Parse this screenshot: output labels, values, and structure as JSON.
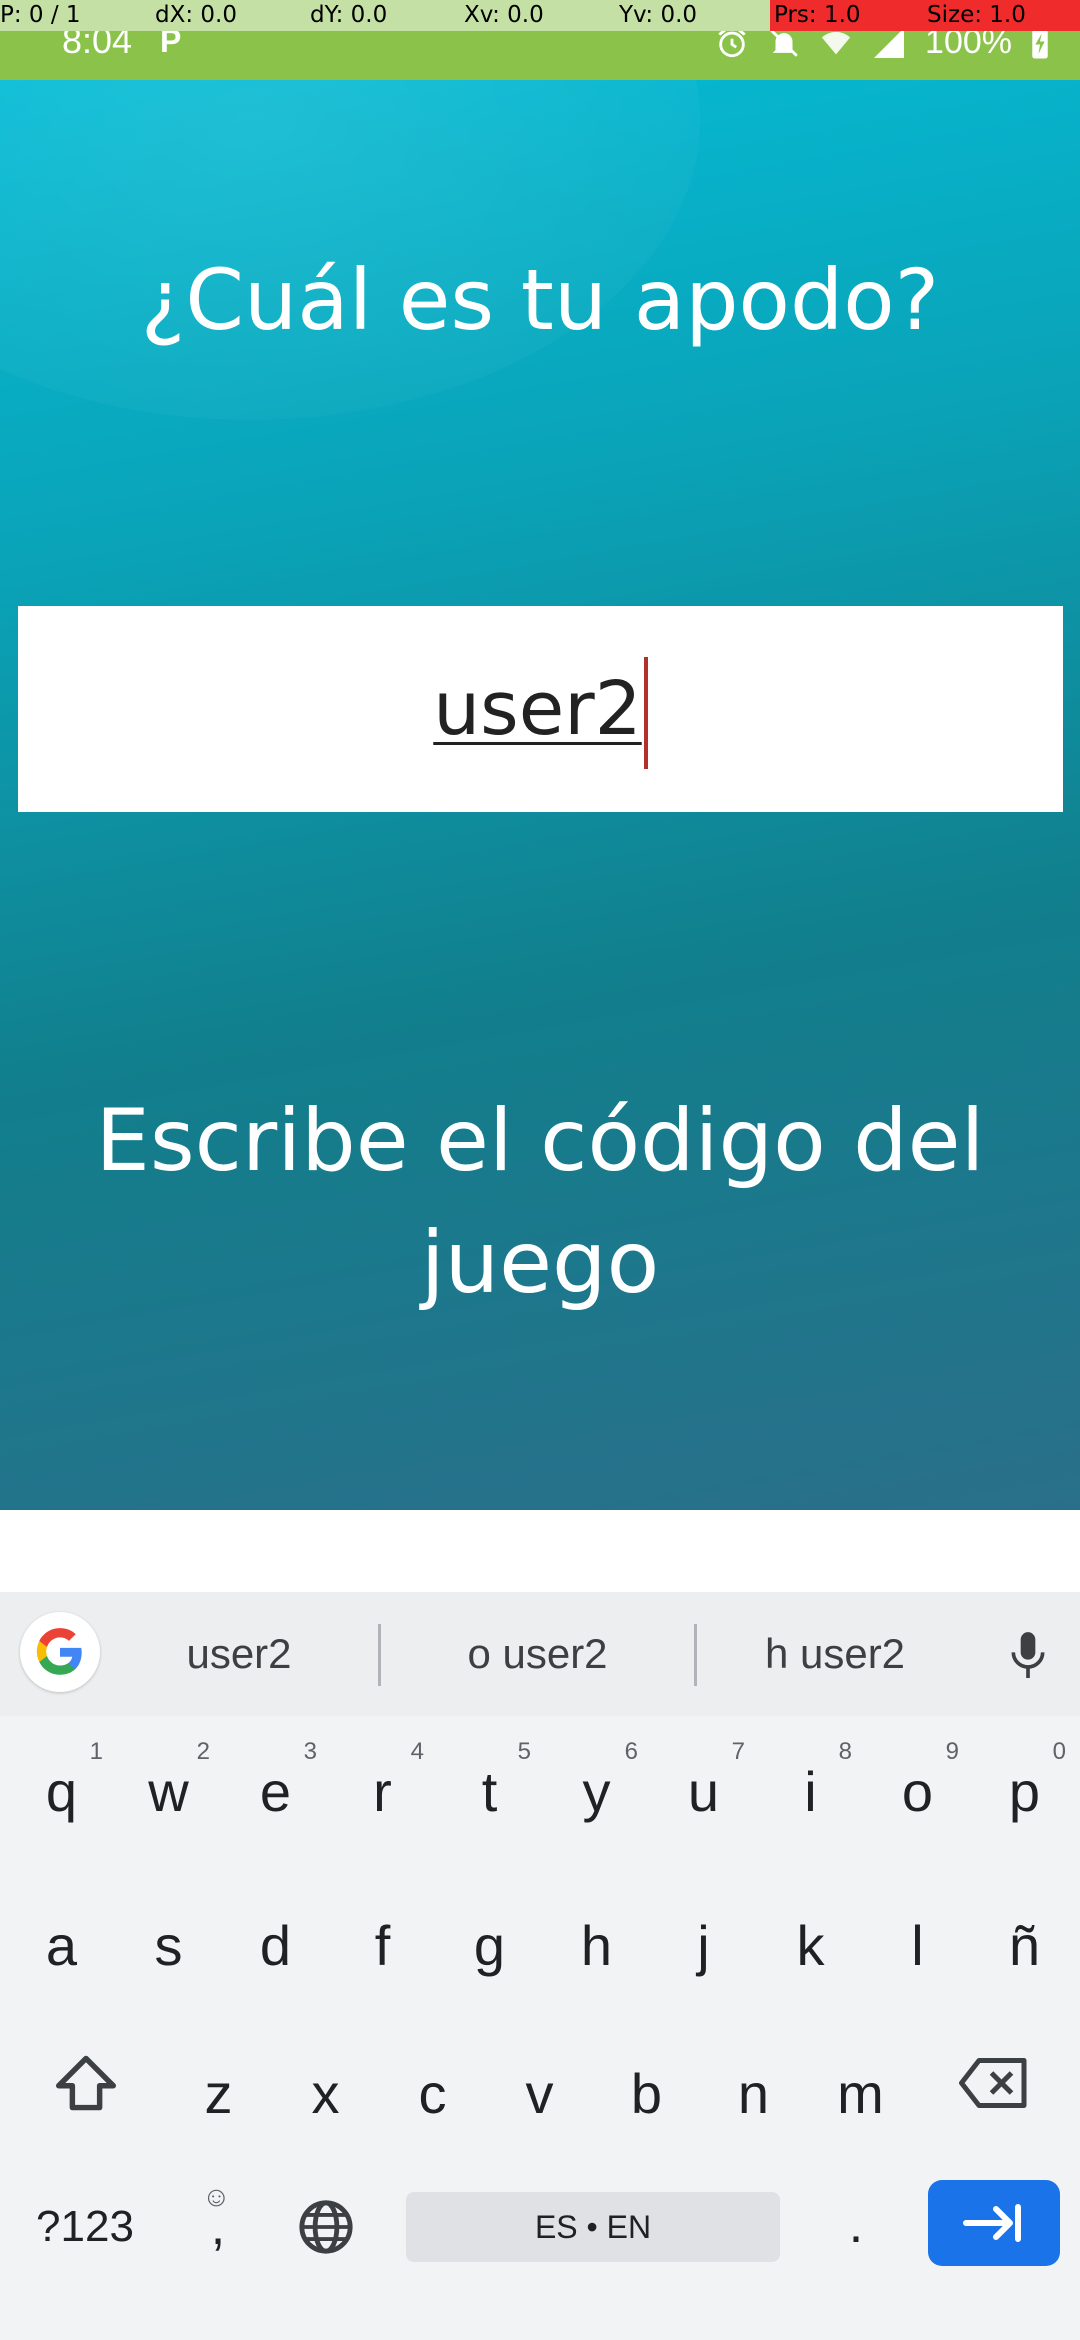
{
  "debug": {
    "p": "P: 0 / 1",
    "dx": "dX: 0.0",
    "dy": "dY: 0.0",
    "xv": "Xv: 0.0",
    "yv": "Yv: 0.0",
    "prs": "Prs: 1.0",
    "size": "Size: 1.0"
  },
  "status_bar": {
    "time": "8:04",
    "notification_letter": "P",
    "battery": "100%",
    "icons": [
      "alarm-icon",
      "mute-icon",
      "wifi-icon",
      "signal-icon",
      "battery-charging-icon"
    ],
    "color": "#8bc34a"
  },
  "screen": {
    "title": "¿Cuál es tu apodo?",
    "nickname_value": "user2",
    "code_title": "Escribe el código del juego",
    "gradient_top": "#05bcd5",
    "gradient_bottom": "#2a6f8a"
  },
  "keyboard": {
    "suggestions": [
      "user2",
      "o user2",
      "h user2"
    ],
    "row1": [
      {
        "key": "q",
        "hint": "1"
      },
      {
        "key": "w",
        "hint": "2"
      },
      {
        "key": "e",
        "hint": "3"
      },
      {
        "key": "r",
        "hint": "4"
      },
      {
        "key": "t",
        "hint": "5"
      },
      {
        "key": "y",
        "hint": "6"
      },
      {
        "key": "u",
        "hint": "7"
      },
      {
        "key": "i",
        "hint": "8"
      },
      {
        "key": "o",
        "hint": "9"
      },
      {
        "key": "p",
        "hint": "0"
      }
    ],
    "row2": [
      "a",
      "s",
      "d",
      "f",
      "g",
      "h",
      "j",
      "k",
      "l",
      "ñ"
    ],
    "row3": [
      "z",
      "x",
      "c",
      "v",
      "b",
      "n",
      "m"
    ],
    "symbols_label": "?123",
    "comma_label": ",",
    "space_label": "ES • EN",
    "period_label": ".",
    "enter_color": "#1a73e8"
  }
}
